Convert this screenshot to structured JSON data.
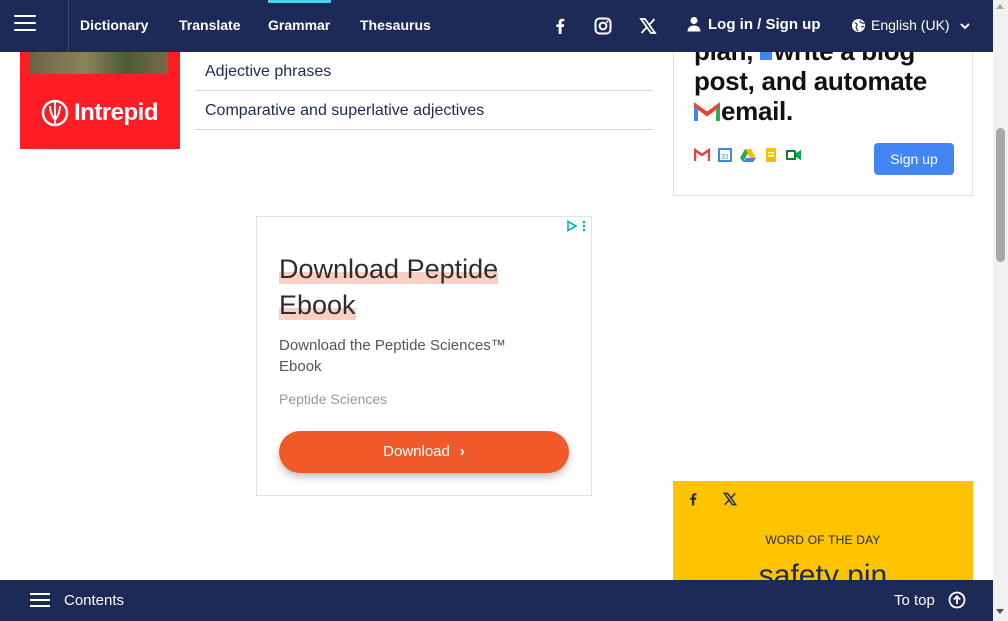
{
  "nav": {
    "links": [
      "Dictionary",
      "Translate",
      "Grammar",
      "Thesaurus"
    ],
    "active": "Grammar",
    "login_label": "Log in / Sign up",
    "language_label": "English (UK)",
    "social_icons": [
      "facebook-icon",
      "instagram-icon",
      "x-icon"
    ]
  },
  "left_ad": {
    "brand": "Intrepid",
    "color": "#ff1d25"
  },
  "related_links": [
    "Adjective phrases",
    "Comparative and superlative adjectives"
  ],
  "right_ad": {
    "headline_line1": "plan, ",
    "headline_line1b": "write a blog",
    "headline_line2": "post, and automate",
    "headline_line3": "email.",
    "button_label": "Sign up",
    "accent": "#4285f4"
  },
  "center_ad": {
    "title_line1": "Download Peptide",
    "title_line2": "Ebook",
    "description": "Download the Peptide Sciences™ Ebook",
    "sponsor": "Peptide Sciences",
    "cta_label": "Download",
    "cta_color": "#f05a2a"
  },
  "word_of_the_day": {
    "label": "WORD OF THE DAY",
    "word": "safety pin",
    "color": "#ffc300"
  },
  "bottom_bar": {
    "contents_label": "Contents",
    "to_top_label": "To top"
  },
  "theme": {
    "navy": "#1d2a57",
    "active_underline": "#4fd0e8"
  }
}
